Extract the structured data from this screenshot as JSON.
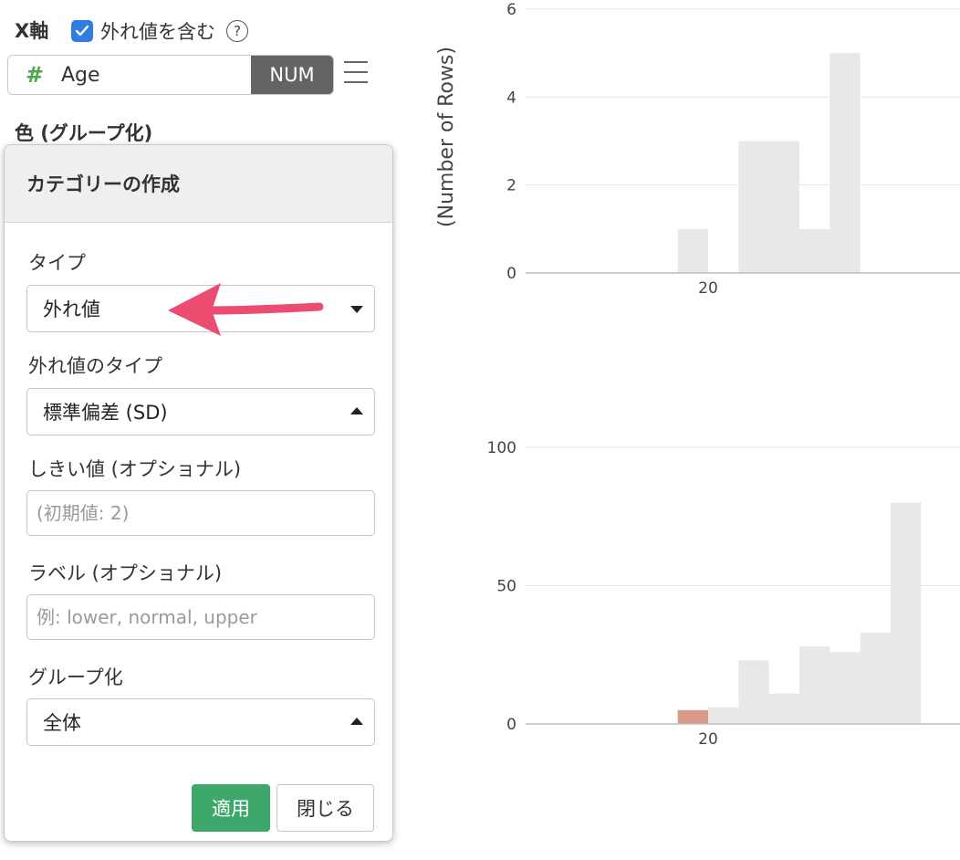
{
  "xaxis": {
    "title": "X軸",
    "include_outliers_label": "外れ値を含む",
    "include_outliers_checked": true,
    "help_icon": "?",
    "column_icon": "#",
    "column_name": "Age",
    "column_type": "NUM"
  },
  "color_section": {
    "title": "色 (グループ化)"
  },
  "panel": {
    "title": "カテゴリーの作成",
    "type_label": "タイプ",
    "type_value": "外れ値",
    "outlier_type_label": "外れ値のタイプ",
    "outlier_type_value": "標準偏差 (SD)",
    "threshold_label": "しきい値 (オプショナル)",
    "threshold_placeholder": "(初期値: 2)",
    "labels_label": "ラベル (オプショナル)",
    "labels_placeholder": "例: lower, normal, upper",
    "grouping_label": "グループ化",
    "grouping_value": "全体",
    "apply_label": "適用",
    "close_label": "閉じる"
  },
  "colors": {
    "accent_blue": "#2f7de1",
    "apply_green": "#3ea86b",
    "arrow_pink": "#ec4c72",
    "bar_gray": "#e8e8e8",
    "outlier_bar": "#d99a8a"
  },
  "chart_data": [
    {
      "type": "bar",
      "ylabel": "(Number of Rows)",
      "ylim": [
        0,
        6
      ],
      "yticks": [
        "0",
        "2",
        "4",
        "6"
      ],
      "xtick_label": "20",
      "series": [
        {
          "bars": [
            {
              "x0": 18,
              "x1": 20,
              "value": 1
            },
            {
              "x0": 22,
              "x1": 24,
              "value": 3
            },
            {
              "x0": 24,
              "x1": 26,
              "value": 3
            },
            {
              "x0": 26,
              "x1": 28,
              "value": 1
            },
            {
              "x0": 28,
              "x1": 30,
              "value": 5
            }
          ]
        }
      ],
      "grid": true
    },
    {
      "type": "bar",
      "ylim": [
        0,
        100
      ],
      "yticks": [
        "0",
        "50",
        "100"
      ],
      "xtick_label": "20",
      "series": [
        {
          "bars": [
            {
              "x0": 20,
              "x1": 22,
              "value": 6
            },
            {
              "x0": 22,
              "x1": 24,
              "value": 23
            },
            {
              "x0": 24,
              "x1": 26,
              "value": 11
            },
            {
              "x0": 26,
              "x1": 28,
              "value": 28
            },
            {
              "x0": 28,
              "x1": 30,
              "value": 26
            },
            {
              "x0": 30,
              "x1": 32,
              "value": 33
            },
            {
              "x0": 32,
              "x1": 34,
              "value": 80
            }
          ]
        },
        {
          "bars": [
            {
              "x0": 18,
              "x1": 20,
              "value": 5
            }
          ]
        }
      ],
      "grid": true
    }
  ]
}
